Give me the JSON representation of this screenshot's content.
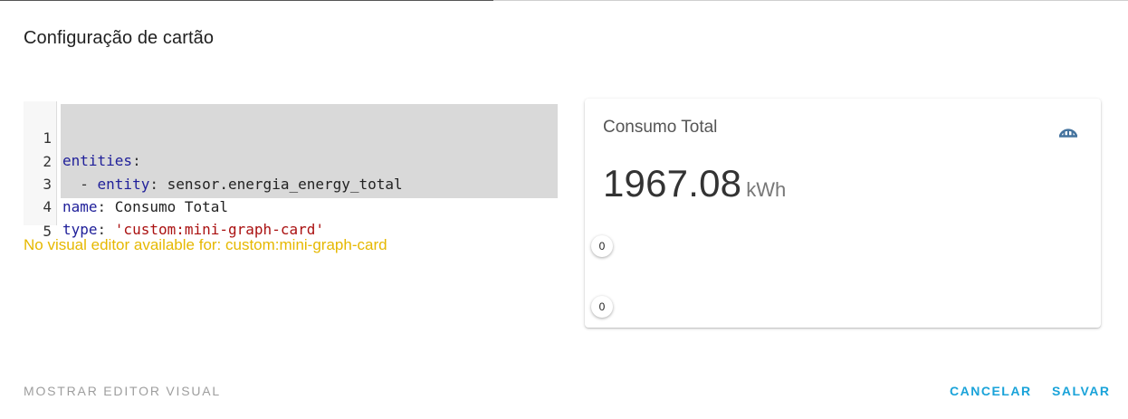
{
  "dialog": {
    "title": "Configuração de cartão"
  },
  "editor": {
    "lines": [
      {
        "number": "1",
        "key": "entities",
        "sep": ":",
        "value": ""
      },
      {
        "number": "2",
        "dash": "  - ",
        "key": "entity",
        "sep": ": ",
        "value": "sensor.energia_energy_total"
      },
      {
        "number": "3",
        "key": "name",
        "sep": ": ",
        "value": "Consumo Total"
      },
      {
        "number": "4",
        "key": "type",
        "sep": ": ",
        "value": "'custom:mini-graph-card'"
      },
      {
        "number": "5"
      }
    ],
    "warning": "No visual editor available for: custom:mini-graph-card"
  },
  "preview": {
    "name": "Consumo Total",
    "icon": "gauge-icon",
    "state": "1967.08",
    "unit": "kWh",
    "points": [
      "0",
      "0"
    ]
  },
  "footer": {
    "show_visual_editor": "MOSTRAR EDITOR VISUAL",
    "cancel": "CANCELAR",
    "save": "SALVAR"
  },
  "colors": {
    "accent": "#1aa3d9",
    "warning": "#e6b800",
    "yaml_key": "#20209a",
    "yaml_string": "#aa1111"
  }
}
